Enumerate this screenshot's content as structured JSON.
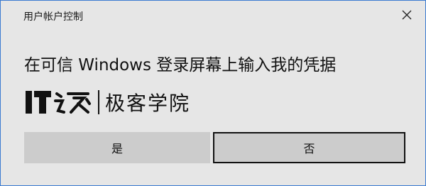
{
  "window": {
    "title": "用户帐户控制"
  },
  "dialog": {
    "heading": "在可信 Windows 登录屏幕上输入我的凭据",
    "brand_logo_text": "IT之家",
    "brand_name": "极客学院"
  },
  "buttons": {
    "yes_label": "是",
    "no_label": "否"
  },
  "icons": {
    "close": "close-icon"
  },
  "colors": {
    "window_border": "#3c7bd1",
    "background": "#e6e6e6",
    "button": "#cccccc",
    "focus_border": "#111111"
  }
}
